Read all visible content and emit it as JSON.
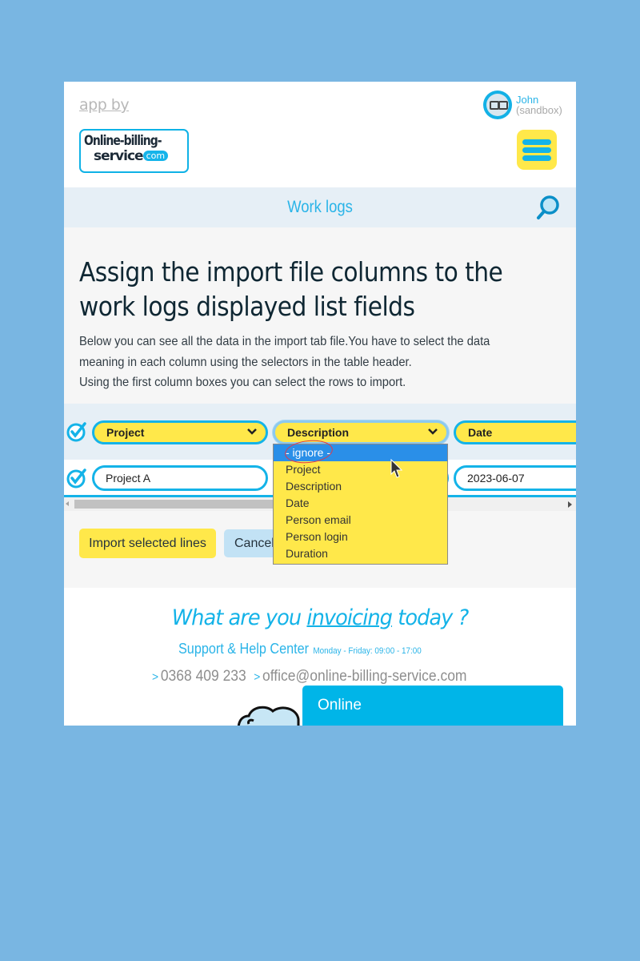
{
  "header": {
    "app_by": "app by",
    "logo": {
      "line1": "Online-billing-",
      "line2": "service",
      "com": "com"
    },
    "user": {
      "name": "John",
      "sub": "(sandbox)"
    }
  },
  "titlebar": {
    "title": "Work logs"
  },
  "main": {
    "heading_line1": "Assign the import file columns to the",
    "heading_line2": "work logs displayed list fields",
    "description": [
      "Below you can see all the data in the import tab file.You have to select the data",
      "meaning in each column using the selectors in the table header.",
      "Using the first column boxes you can select the rows to import."
    ]
  },
  "table": {
    "column_selectors": [
      {
        "selected": "Project"
      },
      {
        "selected": "Description"
      },
      {
        "selected": "Date"
      }
    ],
    "rows": [
      {
        "checked": true,
        "cells": [
          "Project A",
          "",
          "2023-06-07"
        ]
      }
    ]
  },
  "dropdown": {
    "options": [
      "- ignore -",
      "Project",
      "Description",
      "Date",
      "Person email",
      "Person login",
      "Duration"
    ],
    "highlighted": "- ignore -"
  },
  "actions": {
    "import_label": "Import selected lines",
    "cancel_label": "Cancel"
  },
  "footer": {
    "slogan_pre": "What are you ",
    "slogan_em": "invoicing",
    "slogan_post": " today ?",
    "support": "Support & Help Center",
    "hours": "Monday - Friday: 09:00 - 17:00",
    "phone": "0368 409 233",
    "email": "office@online-billing-service.com"
  },
  "chat": {
    "status": "Online"
  },
  "colors": {
    "accent_blue": "#14b3e8",
    "accent_yellow": "#ffe84a",
    "highlight_blue": "#2a8fe8",
    "background": "#79b6e2"
  }
}
